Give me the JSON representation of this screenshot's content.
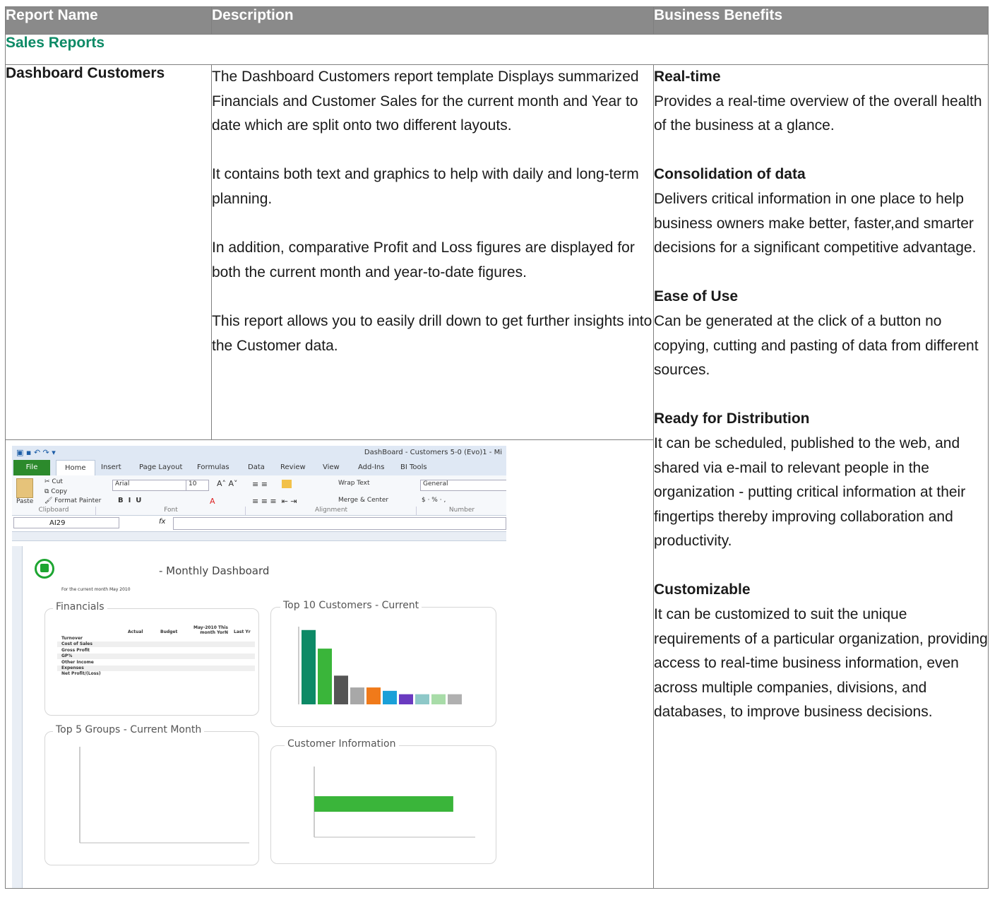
{
  "table": {
    "headers": [
      "Report Name",
      "Description",
      "Business Benefits"
    ],
    "section": "Sales Reports",
    "row": {
      "name": "Dashboard Customers",
      "description": [
        "The Dashboard Customers report template Displays summarized Financials and Customer Sales for the current month and Year to date which are split onto two different layouts.",
        "It contains both text and graphics to help with daily and long-term planning.",
        "In addition, comparative Profit and Loss figures are displayed for both the current month and year-to-date figures.",
        "This report allows you to easily drill down to get further insights into the Customer data."
      ],
      "benefits": [
        {
          "title": "Real-time",
          "text": "Provides a real-time overview of the overall health of the business at a glance."
        },
        {
          "title": "Consolidation of data",
          "text": "Delivers critical information in one place to help business owners make better, faster,and smarter decisions for a significant competitive advantage."
        },
        {
          "title": "Ease of Use",
          "text": "Can be generated at the click of a button no copying, cutting and pasting of data from different sources."
        },
        {
          "title": "Ready for Distribution",
          "text": "It can be scheduled, published to the web, and shared via e-mail to relevant people in the organization - putting critical information at their fingertips thereby improving collaboration and productivity."
        },
        {
          "title": "Customizable",
          "text": "It can be customized to suit the unique requirements of a particular organization, providing access to real-time business information, even across multiple companies, divisions, and databases, to improve business decisions."
        }
      ]
    }
  },
  "screenshot": {
    "window_title": "DashBoard - Customers 5-0 (Evo)1 - Mi",
    "tabs": [
      "File",
      "Home",
      "Insert",
      "Page Layout",
      "Formulas",
      "Data",
      "Review",
      "View",
      "Add-Ins",
      "BI Tools"
    ],
    "ribbon": {
      "cut": "Cut",
      "copy": "Copy",
      "paste": "Paste",
      "format_painter": "Format Painter",
      "font_name": "Arial",
      "font_size": "10",
      "wrap_text": "Wrap Text",
      "merge": "Merge & Center",
      "number_format": "General",
      "groups": [
        "Clipboard",
        "Font",
        "Alignment",
        "Number"
      ]
    },
    "name_box": "AI29",
    "fx": "fx",
    "dashboard_title": "- Monthly Dashboard",
    "subtitle": "For the current month May 2010",
    "financials": {
      "title": "Financials",
      "columns": [
        "Actual",
        "Budget",
        "May-2010 This month YorN",
        "Last Yr"
      ],
      "rows": [
        "Turnover",
        "Cost of Sales",
        "Gross Profit",
        "GP%",
        "Other Income",
        "Expenses",
        "Net Profit/(Loss)"
      ]
    },
    "top10": {
      "title": "Top 10 Customers - Current",
      "values": [
        440,
        330,
        170,
        100,
        100,
        80,
        60,
        60,
        60,
        60
      ],
      "colors": [
        "#0d8a66",
        "#3ab53a",
        "#555555",
        "#a8a8a8",
        "#f07a1a",
        "#1aa0d8",
        "#6a3ac0",
        "#8ec8c8",
        "#a8dca8",
        "#b0b0b0"
      ]
    },
    "top5": {
      "title": "Top 5 Groups - Current Month"
    },
    "custinfo": {
      "title": "Customer Information",
      "bar_fraction": 0.55
    }
  }
}
